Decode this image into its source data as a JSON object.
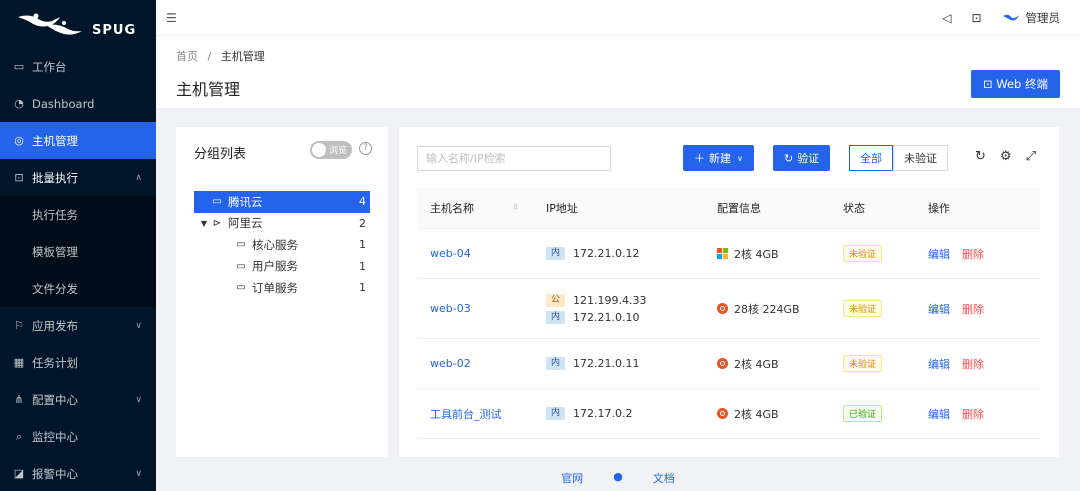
{
  "logo": {
    "text": "SPUG"
  },
  "sidebar": {
    "items": [
      {
        "label": "工作台",
        "icon": "desktop-icon",
        "glyph": "▭"
      },
      {
        "label": "Dashboard",
        "icon": "dashboard-icon",
        "glyph": "◔"
      },
      {
        "label": "主机管理",
        "icon": "cloud-server-icon",
        "glyph": "◎",
        "active": true
      },
      {
        "label": "批量执行",
        "icon": "terminal-icon",
        "glyph": "⊡",
        "open": true,
        "children": [
          "执行任务",
          "模板管理",
          "文件分发"
        ]
      },
      {
        "label": "应用发布",
        "icon": "flag-icon",
        "glyph": "⚐",
        "caret": true
      },
      {
        "label": "任务计划",
        "icon": "schedule-icon",
        "glyph": "▦"
      },
      {
        "label": "配置中心",
        "icon": "cluster-icon",
        "glyph": "⋔",
        "caret": true
      },
      {
        "label": "监控中心",
        "icon": "monitor-icon",
        "glyph": "⌕"
      },
      {
        "label": "报警中心",
        "icon": "alert-icon",
        "glyph": "◪",
        "caret": true
      }
    ]
  },
  "topbar": {
    "user": "管理员"
  },
  "breadcrumb": {
    "home": "首页",
    "sep": "/",
    "current": "主机管理"
  },
  "page": {
    "title": "主机管理",
    "web_terminal": "Web 终端"
  },
  "groups": {
    "title": "分组列表",
    "switch_label": "浏览",
    "tree": [
      {
        "label": "腾讯云",
        "count": "4",
        "level": 0,
        "selected": true
      },
      {
        "label": "阿里云",
        "count": "2",
        "level": 0,
        "expanded": true
      },
      {
        "label": "核心服务",
        "count": "1",
        "level": 1
      },
      {
        "label": "用户服务",
        "count": "1",
        "level": 1
      },
      {
        "label": "订单服务",
        "count": "1",
        "level": 1
      }
    ]
  },
  "toolbar": {
    "search_placeholder": "输入名称/IP检索",
    "new_label": "新建",
    "verify_label": "验证",
    "filter": [
      "全部",
      "未验证"
    ]
  },
  "table": {
    "headers": [
      "主机名称",
      "IP地址",
      "配置信息",
      "状态",
      "操作"
    ],
    "rows": [
      {
        "name": "web-04",
        "ips": [
          {
            "tag": "内",
            "ip": "172.21.0.12"
          }
        ],
        "os": "other",
        "config": "2核 4GB",
        "status": "未验证",
        "verified": false
      },
      {
        "name": "web-03",
        "ips": [
          {
            "tag": "公",
            "ip": "121.199.4.33"
          },
          {
            "tag": "内",
            "ip": "172.21.0.10"
          }
        ],
        "os": "ubuntu",
        "config": "28核 224GB",
        "status": "未验证",
        "verified": false
      },
      {
        "name": "web-02",
        "ips": [
          {
            "tag": "内",
            "ip": "172.21.0.11"
          }
        ],
        "os": "ubuntu",
        "config": "2核 4GB",
        "status": "未验证",
        "verified": false
      },
      {
        "name": "工具前台_测试",
        "ips": [
          {
            "tag": "内",
            "ip": "172.17.0.2"
          }
        ],
        "os": "ubuntu",
        "config": "2核 4GB",
        "status": "已验证",
        "verified": true
      }
    ],
    "edit": "编辑",
    "delete": "删除"
  },
  "footer": {
    "links": [
      "官网",
      "文档"
    ]
  },
  "colors": {
    "primary": "#2563eb",
    "sidebar_bg": "#001529",
    "danger": "#ff4d4f"
  }
}
